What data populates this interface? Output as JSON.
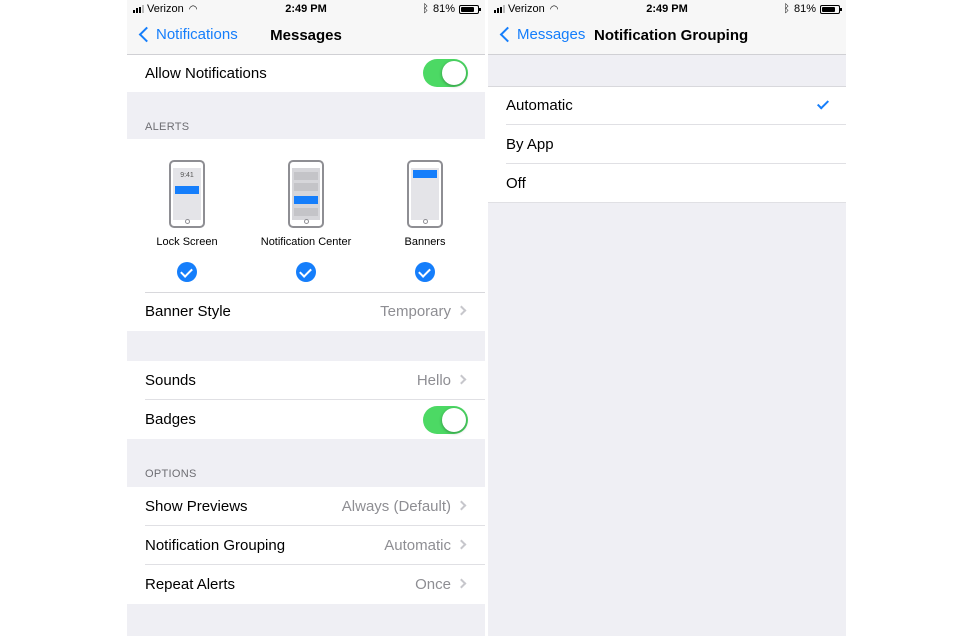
{
  "left_screen": {
    "status": {
      "carrier": "Verizon",
      "time": "2:49 PM",
      "battery": "81%",
      "battery_level": 0.81
    },
    "nav": {
      "back_label": "Notifications",
      "title": "Messages"
    },
    "allow_notifications": {
      "label": "Allow Notifications",
      "on": true
    },
    "alerts": {
      "header": "ALERTS",
      "items": [
        {
          "label": "Lock Screen",
          "checked": true,
          "preview_time": "9:41"
        },
        {
          "label": "Notification Center",
          "checked": true
        },
        {
          "label": "Banners",
          "checked": true
        }
      ]
    },
    "banner_style": {
      "label": "Banner Style",
      "value": "Temporary"
    },
    "sounds": {
      "label": "Sounds",
      "value": "Hello"
    },
    "badges": {
      "label": "Badges",
      "on": true
    },
    "options": {
      "header": "OPTIONS",
      "items": [
        {
          "label": "Show Previews",
          "value": "Always (Default)"
        },
        {
          "label": "Notification Grouping",
          "value": "Automatic"
        },
        {
          "label": "Repeat Alerts",
          "value": "Once"
        }
      ]
    }
  },
  "right_screen": {
    "status": {
      "carrier": "Verizon",
      "time": "2:49 PM",
      "battery": "81%",
      "battery_level": 0.81
    },
    "nav": {
      "back_label": "Messages",
      "title": "Notification Grouping"
    },
    "options": [
      {
        "label": "Automatic",
        "selected": true
      },
      {
        "label": "By App",
        "selected": false
      },
      {
        "label": "Off",
        "selected": false
      }
    ]
  },
  "colors": {
    "accent": "#157efb",
    "toggle_on": "#4cd964",
    "group_background": "#efeff4",
    "secondary_text": "#8e8e93"
  }
}
